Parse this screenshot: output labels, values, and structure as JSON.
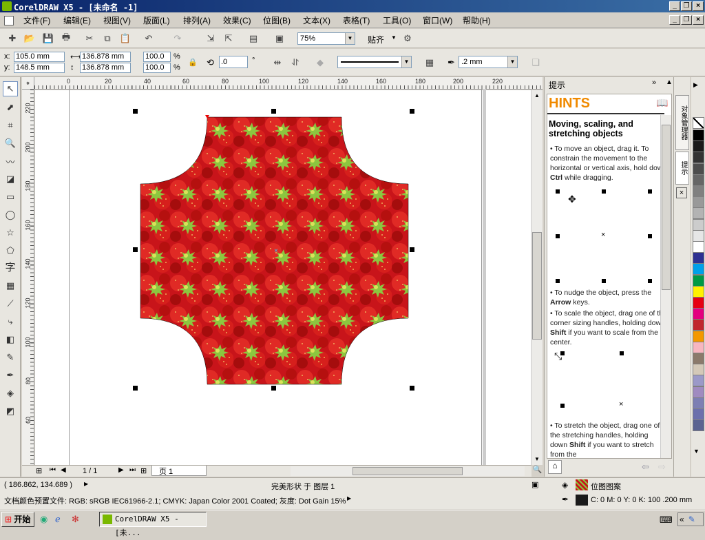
{
  "window": {
    "title": "CorelDRAW X5 - [未命名 -1]"
  },
  "menu": [
    {
      "label": "文件(F)"
    },
    {
      "label": "编辑(E)"
    },
    {
      "label": "视图(V)"
    },
    {
      "label": "版面(L)"
    },
    {
      "label": "排列(A)"
    },
    {
      "label": "效果(C)"
    },
    {
      "label": "位图(B)"
    },
    {
      "label": "文本(X)"
    },
    {
      "label": "表格(T)"
    },
    {
      "label": "工具(O)"
    },
    {
      "label": "窗口(W)"
    },
    {
      "label": "帮助(H)"
    }
  ],
  "toolbar": {
    "zoom": "75%",
    "snap_label": "贴齐"
  },
  "property_bar": {
    "x_label": "x:",
    "x_value": "105.0 mm",
    "y_label": "y:",
    "y_value": "148.5 mm",
    "width_value": "136.878 mm",
    "height_value": "136.878 mm",
    "scale_x": "100.0",
    "scale_y": "100.0",
    "percent": "%",
    "rotation": ".0",
    "degree": "°",
    "outline_width": ".2 mm"
  },
  "ruler": {
    "top": [
      "0",
      "20",
      "40",
      "60",
      "80",
      "100",
      "120",
      "140",
      "160",
      "180",
      "200",
      "220"
    ],
    "left": [
      "220",
      "200",
      "180",
      "160",
      "140",
      "120",
      "100",
      "80",
      "60"
    ]
  },
  "pager": {
    "count": "1 / 1",
    "page_tab": "页 1"
  },
  "docker": {
    "header": "提示",
    "hints_title": "HINTS",
    "topic": "Moving, scaling, and stretching objects",
    "bullets": [
      "To move an object, drag it. To constrain the movement to the horizontal or vertical axis, hold down Ctrl while dragging.",
      "To nudge the object, press the Arrow keys.",
      "To scale the object, drag one of the corner sizing handles, holding down Shift if you want to scale from the center.",
      "To stretch the object, drag one of the stretching handles, holding down Shift if you want to stretch from the"
    ]
  },
  "sidetabs": {
    "objects": "对象管理器",
    "hints": "提示"
  },
  "palette": [
    "#ffffff",
    "#000000",
    "#1a1a1a",
    "#333333",
    "#4d4d4d",
    "#666666",
    "#808080",
    "#999999",
    "#b3b3b3",
    "#cccccc",
    "#e6e6e6",
    "#ffffff",
    "#2e3192",
    "#00a0e9",
    "#009944",
    "#fff100",
    "#e60012",
    "#e4007f",
    "#c1272d",
    "#f39800",
    "#f7b6c0",
    "#8b7a6b",
    "#d4c9b8",
    "#9b99c8",
    "#a08bc0",
    "#7d7fb3",
    "#6c70ac",
    "#5b6391"
  ],
  "status": {
    "coords": "( 186.862, 134.689 )",
    "selection": "完美形状 于 图层 1",
    "fill_label": "位图图案",
    "color_profile": "文档颜色预置文件: RGB: sRGB IEC61966-2.1; CMYK: Japan Color 2001 Coated; 灰度: Dot Gain 15%",
    "outline": "C: 0 M: 0 Y: 0 K: 100  .200 mm"
  },
  "taskbar": {
    "start": "开始",
    "app": "CorelDRAW X5 - [未..."
  }
}
